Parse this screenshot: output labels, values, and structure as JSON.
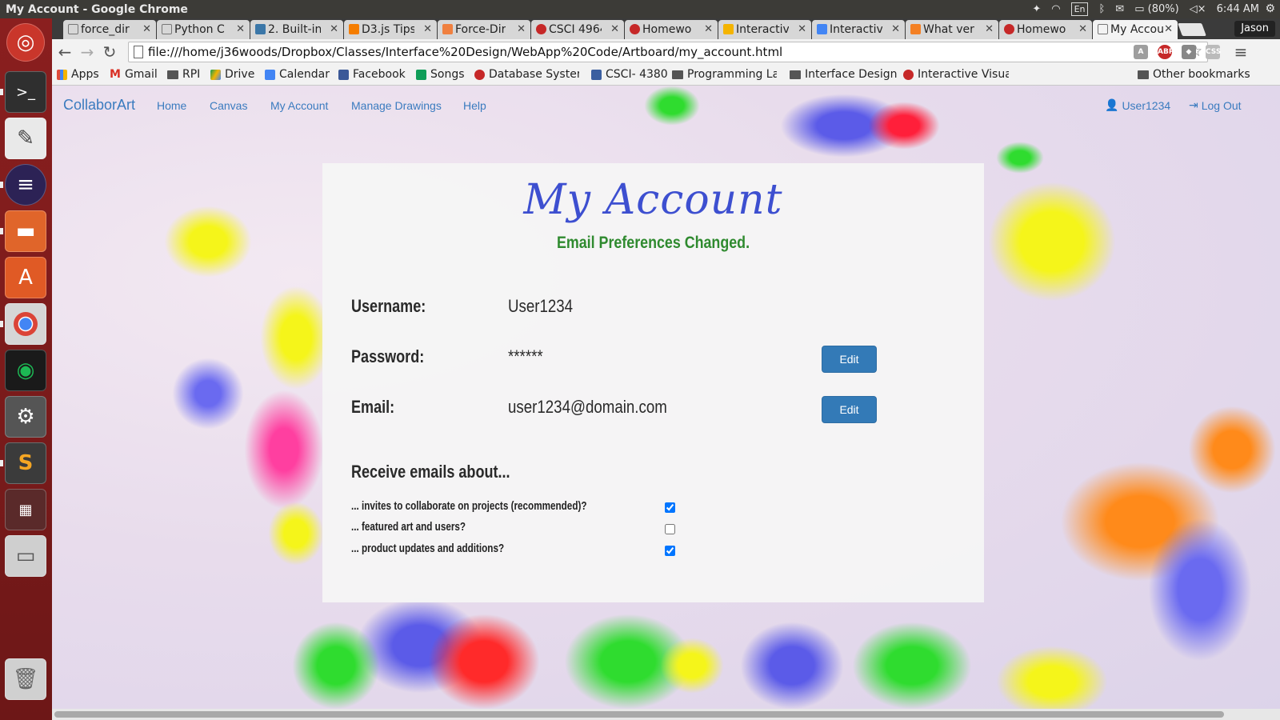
{
  "window": {
    "title": "My Account - Google Chrome",
    "indicators": {
      "language": "En",
      "battery": "(80%)",
      "time": "6:44 AM"
    }
  },
  "tabs": [
    {
      "label": "force_dir",
      "favicon": "file-icon",
      "color": "#ffffff"
    },
    {
      "label": "Python C",
      "favicon": "python-docs-icon",
      "color": "#ffffff"
    },
    {
      "label": "2. Built-in",
      "favicon": "python-icon",
      "color": "#3b77a8"
    },
    {
      "label": "D3.js Tips",
      "favicon": "blogger-icon",
      "color": "#f57d00"
    },
    {
      "label": "Force-Dir",
      "favicon": "d3-icon",
      "color": "#f08040"
    },
    {
      "label": "CSCI 4964",
      "favicon": "cs-icon",
      "color": "#c62828"
    },
    {
      "label": "Homewo",
      "favicon": "cs-icon",
      "color": "#c62828"
    },
    {
      "label": "Interactiv",
      "favicon": "slides-icon",
      "color": "#f4b400"
    },
    {
      "label": "Interactiv",
      "favicon": "docs-icon",
      "color": "#4285f4"
    },
    {
      "label": "What ver",
      "favicon": "stackoverflow-icon",
      "color": "#f48024"
    },
    {
      "label": "Homewo",
      "favicon": "cs-icon",
      "color": "#c62828"
    },
    {
      "label": "My Accou",
      "favicon": "file-icon",
      "color": "#ffffff"
    }
  ],
  "profile": "Jason",
  "address": "file:///home/j36woods/Dropbox/Classes/Interface%20Design/WebApp%20Code/Artboard/my_account.html",
  "bookmarks": [
    {
      "label": "Apps",
      "icon": "apps-icon"
    },
    {
      "label": "Gmail",
      "icon": "gmail-icon"
    },
    {
      "label": "RPI",
      "icon": "folder-icon"
    },
    {
      "label": "Drive",
      "icon": "drive-icon"
    },
    {
      "label": "Calendar",
      "icon": "calendar-icon"
    },
    {
      "label": "Facebook",
      "icon": "facebook-icon"
    },
    {
      "label": "Songs",
      "icon": "sheets-icon"
    },
    {
      "label": "Database System",
      "icon": "cs-icon"
    },
    {
      "label": "CSCI- 4380",
      "icon": "p-icon"
    },
    {
      "label": "Programming La",
      "icon": "folder-icon"
    },
    {
      "label": "Interface Design",
      "icon": "folder-icon"
    },
    {
      "label": "Interactive Visua",
      "icon": "cs-icon"
    }
  ],
  "other_bookmarks": "Other bookmarks",
  "site": {
    "brand": "CollaborArt",
    "nav": [
      "Home",
      "Canvas",
      "My Account",
      "Manage Drawings",
      "Help"
    ],
    "user": "User1234",
    "logout": "Log Out"
  },
  "account": {
    "title": "My Account",
    "status": "Email Preferences Changed.",
    "status_color": "#2f8a2f",
    "username_label": "Username:",
    "username_value": "User1234",
    "password_label": "Password:",
    "password_value": "******",
    "email_label": "Email:",
    "email_value": "user1234@domain.com",
    "edit_label": "Edit",
    "emails_heading": "Receive emails about...",
    "prefs": [
      {
        "label": "... invites to collaborate on projects (recommended)?",
        "checked": true
      },
      {
        "label": "... featured art and users?",
        "checked": false
      },
      {
        "label": "... product updates and additions?",
        "checked": true
      }
    ]
  },
  "colors": {
    "accent": "#337ab7",
    "title": "#3d4fd0",
    "launcher": "#7a1b1b"
  }
}
